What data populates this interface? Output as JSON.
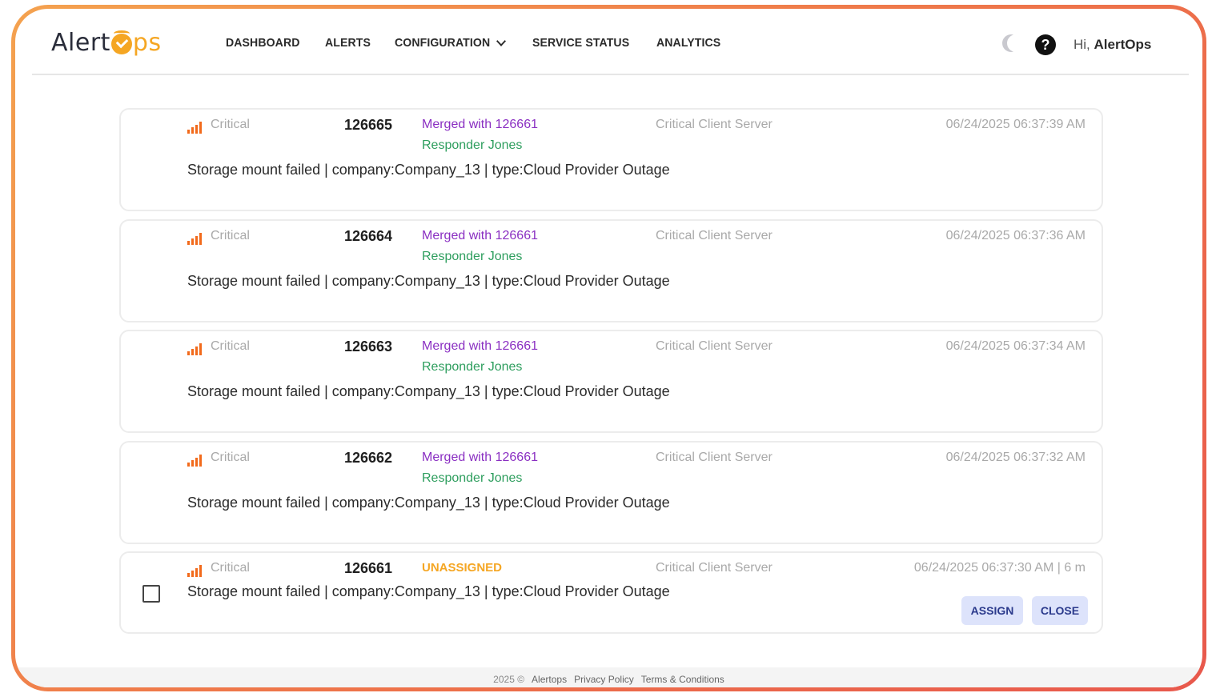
{
  "brand": {
    "logo_left": "Alert",
    "logo_right": "ps"
  },
  "nav": {
    "items": [
      {
        "label": "DASHBOARD"
      },
      {
        "label": "ALERTS"
      },
      {
        "label": "CONFIGURATION"
      },
      {
        "label": "SERVICE STATUS"
      },
      {
        "label": "ANALYTICS"
      }
    ]
  },
  "header": {
    "greeting_prefix": "Hi,",
    "user_name": "AlertOps",
    "help_glyph": "?"
  },
  "alerts": [
    {
      "severity": "Critical",
      "id": "126665",
      "status": "Merged with 126661",
      "responder": "Responder Jones",
      "source": "Critical Client Server",
      "timestamp": "06/24/2025 06:37:39 AM",
      "message": "Storage mount failed | company:Company_13 | type:Cloud Provider Outage"
    },
    {
      "severity": "Critical",
      "id": "126664",
      "status": "Merged with 126661",
      "responder": "Responder Jones",
      "source": "Critical Client Server",
      "timestamp": "06/24/2025 06:37:36 AM",
      "message": "Storage mount failed | company:Company_13 | type:Cloud Provider Outage"
    },
    {
      "severity": "Critical",
      "id": "126663",
      "status": "Merged with 126661",
      "responder": "Responder Jones",
      "source": "Critical Client Server",
      "timestamp": "06/24/2025 06:37:34 AM",
      "message": "Storage mount failed | company:Company_13 | type:Cloud Provider Outage"
    },
    {
      "severity": "Critical",
      "id": "126662",
      "status": "Merged with 126661",
      "responder": "Responder Jones",
      "source": "Critical Client Server",
      "timestamp": "06/24/2025 06:37:32 AM",
      "message": "Storage mount failed | company:Company_13 | type:Cloud Provider Outage"
    },
    {
      "severity": "Critical",
      "id": "126661",
      "status": "UNASSIGNED",
      "source": "Critical Client Server",
      "timestamp": "06/24/2025 06:37:30 AM | 6 m",
      "message": "Storage mount failed | company:Company_13 | type:Cloud Provider Outage",
      "assign_label": "ASSIGN",
      "close_label": "CLOSE"
    }
  ],
  "footer": {
    "copyright": "2025 ©",
    "company": "Alertops",
    "privacy": "Privacy Policy",
    "terms": "Terms & Conditions"
  },
  "colors": {
    "accent": "#f5a623",
    "merged": "#8a2fc2",
    "responder": "#2e9e5e",
    "severity": "#f26a1b",
    "button_bg": "#dde3fb",
    "button_text": "#2b3a8c"
  }
}
